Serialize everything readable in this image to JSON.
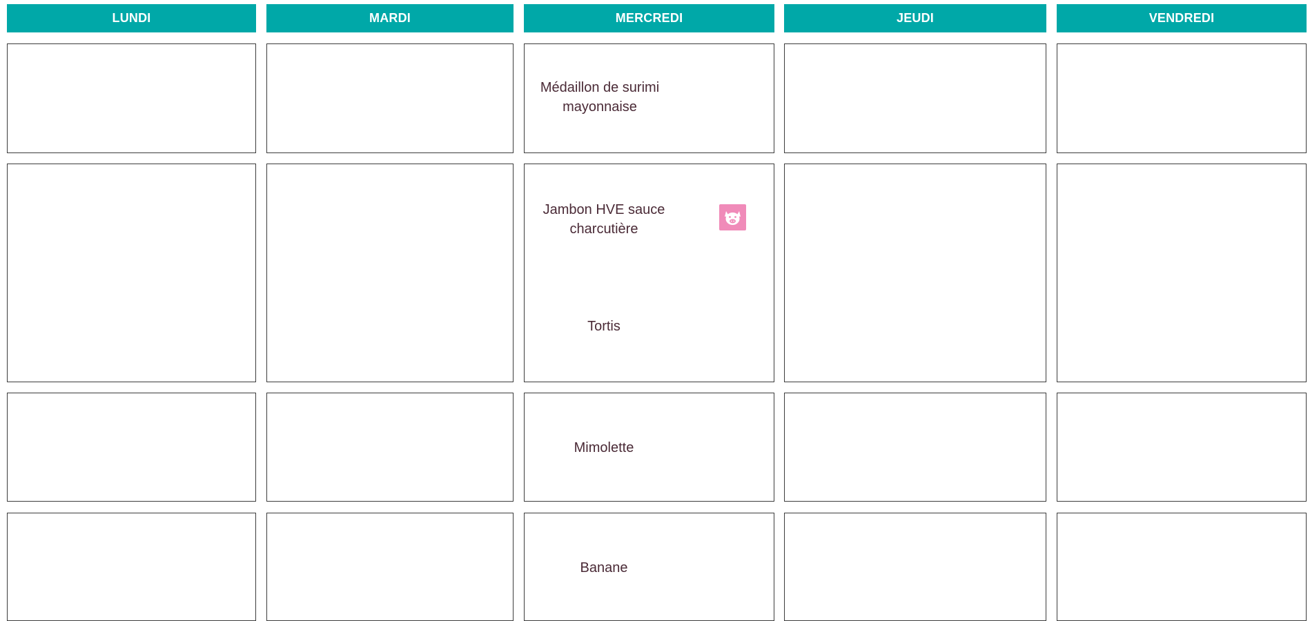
{
  "days": [
    "LUNDI",
    "MARDI",
    "MERCREDI",
    "JEUDI",
    "VENDREDI"
  ],
  "menu": {
    "mercredi": {
      "entree": "Médaillon de surimi mayonnaise",
      "plat": "Jambon HVE sauce charcutière",
      "accompagnement": "Tortis",
      "fromage": "Mimolette",
      "dessert": "Banane"
    }
  },
  "icons": {
    "pork": "pig-icon"
  },
  "colors": {
    "header": "#00a8a8",
    "pork_badge": "#f08bb9",
    "text": "#4a2a36"
  }
}
